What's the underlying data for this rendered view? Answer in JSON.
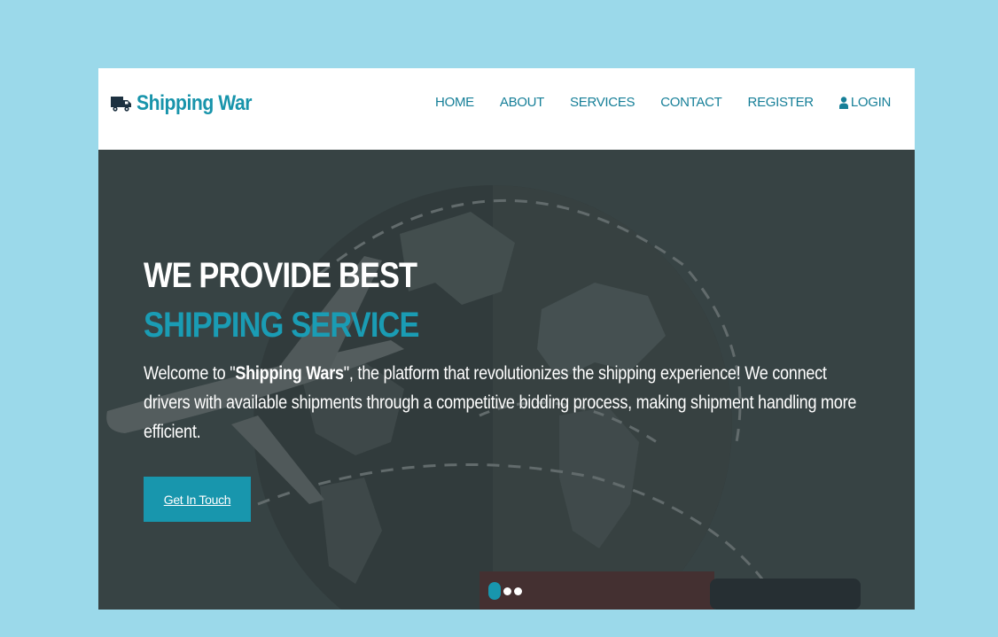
{
  "brand": {
    "name": "Shipping War",
    "icon": "truck-icon",
    "color": "#1894ab"
  },
  "nav": {
    "items": [
      {
        "label": "HOME"
      },
      {
        "label": "ABOUT"
      },
      {
        "label": "SERVICES"
      },
      {
        "label": "CONTACT"
      },
      {
        "label": "REGISTER"
      },
      {
        "label": "LOGIN",
        "icon": "user-icon"
      }
    ]
  },
  "hero": {
    "title_line1": "WE PROVIDE BEST",
    "title_line2": "SHIPPING SERVICE",
    "text_before": "Welcome to \"",
    "text_bold": "Shipping Wars",
    "text_after": "\", the platform that revolutionizes the shipping experience! We connect drivers with available shipments through a competitive bidding process, making shipment handling more efficient.",
    "cta_label": "Get In Touch",
    "slides": 3,
    "active_slide": 1
  },
  "colors": {
    "accent": "#1896ad",
    "page_background": "#9bd9ea",
    "hero_overlay": "#3c4849"
  }
}
